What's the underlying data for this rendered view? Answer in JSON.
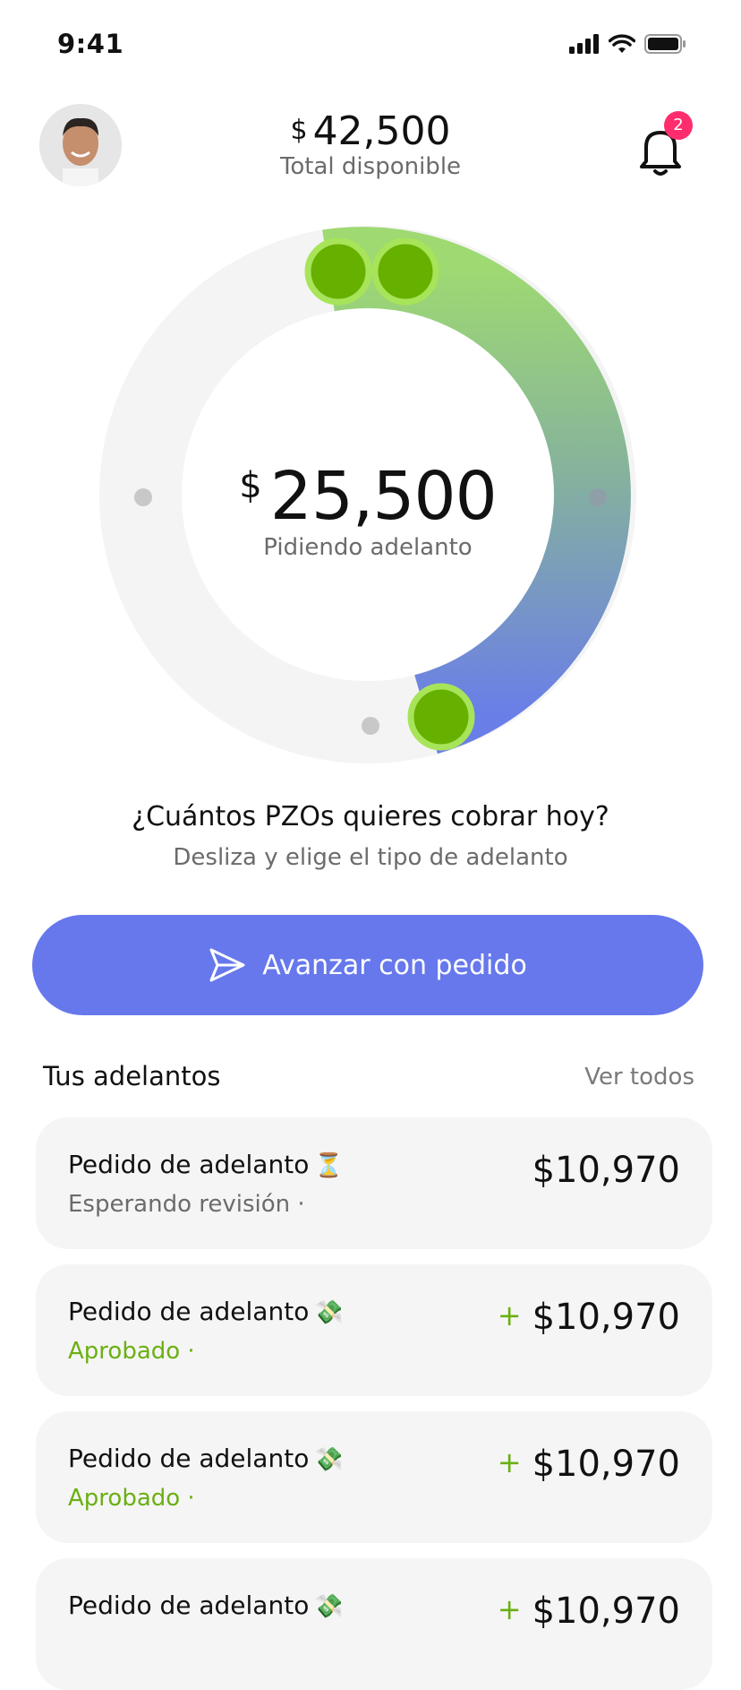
{
  "status_bar": {
    "time": "9:41"
  },
  "header": {
    "balance_currency": "$",
    "balance_amount": "42,500",
    "balance_label": "Total disponible",
    "notification_count": "2"
  },
  "dial": {
    "currency": "$",
    "amount": "25,500",
    "label": "Pidiendo adelanto",
    "gradient_start": "#9ed972",
    "gradient_end": "#6a7ee8",
    "knob_color": "#66b000",
    "knob_ring": "#a8e45a"
  },
  "prompt": {
    "question": "¿Cuántos PZOs quieres cobrar hoy?",
    "hint": "Desliza y elige el tipo de adelanto"
  },
  "cta": {
    "label": "Avanzar con pedido",
    "color": "#6678ec"
  },
  "advances": {
    "title": "Tus adelantos",
    "see_all": "Ver todos",
    "items": [
      {
        "title": "Pedido de adelanto",
        "emoji": "⏳",
        "status": "Esperando revisión ·",
        "sign": "",
        "amount": "$10,970",
        "status_color": "#6b6b6b"
      },
      {
        "title": "Pedido de adelanto",
        "emoji": "💸",
        "status": "Aprobado ·",
        "sign": "+",
        "amount": "$10,970",
        "status_color": "#6ab011"
      },
      {
        "title": "Pedido de adelanto",
        "emoji": "💸",
        "status": "Aprobado ·",
        "sign": "+",
        "amount": "$10,970",
        "status_color": "#6ab011"
      },
      {
        "title": "Pedido de adelanto",
        "emoji": "💸",
        "status": "",
        "sign": "+",
        "amount": "$10,970",
        "status_color": "#6ab011"
      }
    ]
  }
}
